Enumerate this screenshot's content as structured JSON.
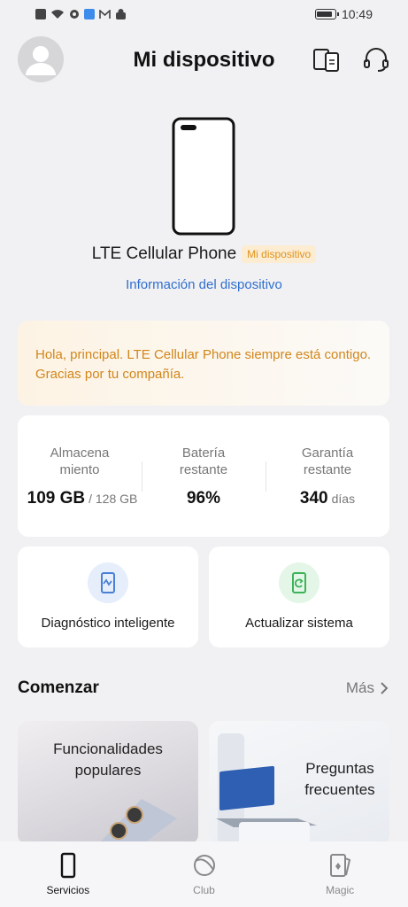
{
  "status_bar": {
    "time": "10:49"
  },
  "header": {
    "title": "Mi dispositivo"
  },
  "device": {
    "name": "LTE Cellular Phone",
    "badge": "Mi dispositivo",
    "info_link": "Información del dispositivo"
  },
  "greeting": {
    "text": "Hola, principal. LTE Cellular Phone siempre está contigo. Gracias por tu compañía."
  },
  "stats": {
    "storage": {
      "label_line1": "Almacena",
      "label_line2": "miento",
      "value": "109 GB",
      "unit": "/ 128 GB"
    },
    "battery": {
      "label_line1": "Batería",
      "label_line2": "restante",
      "value": "96%",
      "unit": ""
    },
    "warranty": {
      "label_line1": "Garantía",
      "label_line2": "restante",
      "value": "340",
      "unit": "días"
    }
  },
  "tools": {
    "diagnostics": {
      "label": "Diagnóstico inteligente",
      "icon": "diagnostics-icon",
      "color": "#4a7fd6"
    },
    "update": {
      "label": "Actualizar sistema",
      "icon": "system-update-icon",
      "color": "#3db35a"
    }
  },
  "start_section": {
    "title": "Comenzar",
    "more_label": "Más",
    "cards": [
      {
        "title_line1": "Funcionalidades",
        "title_line2": "populares"
      },
      {
        "title_line1": "Preguntas",
        "title_line2": "frecuentes"
      }
    ]
  },
  "bottom_nav": {
    "items": [
      {
        "label": "Servicios",
        "icon": "phone-icon",
        "active": true
      },
      {
        "label": "Club",
        "icon": "club-icon",
        "active": false
      },
      {
        "label": "Magic",
        "icon": "magic-icon",
        "active": false
      }
    ]
  },
  "colors": {
    "accent_blue": "#2f6fcf",
    "accent_orange": "#d1861a",
    "background": "#f1f1f3"
  }
}
